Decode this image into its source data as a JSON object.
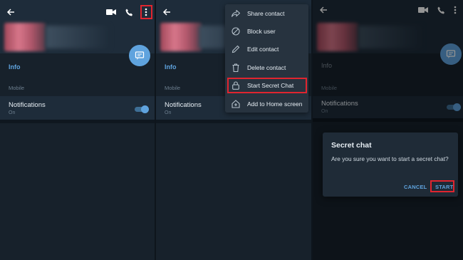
{
  "colors": {
    "accent": "#5fa3de",
    "highlight": "#e0252f",
    "background": "#17212b"
  },
  "panel1": {
    "info": "Info",
    "mobile": "Mobile",
    "notifications": "Notifications",
    "notifications_state": "On",
    "notifications_enabled": true
  },
  "panel2": {
    "info": "Info",
    "mobile": "Mobile",
    "notifications": "Notifications",
    "notifications_state": "On",
    "menu": [
      {
        "label": "Share contact",
        "icon": "share-icon"
      },
      {
        "label": "Block user",
        "icon": "block-icon"
      },
      {
        "label": "Edit contact",
        "icon": "edit-icon"
      },
      {
        "label": "Delete contact",
        "icon": "trash-icon"
      },
      {
        "label": "Start Secret Chat",
        "icon": "lock-icon"
      },
      {
        "label": "Add to Home screen",
        "icon": "add-home-icon"
      }
    ]
  },
  "panel3": {
    "info": "Info",
    "mobile": "Mobile",
    "notifications": "Notifications",
    "notifications_state": "On",
    "dialog": {
      "title": "Secret chat",
      "body": "Are you sure you want to start a secret chat?",
      "cancel": "CANCEL",
      "start": "START"
    }
  }
}
